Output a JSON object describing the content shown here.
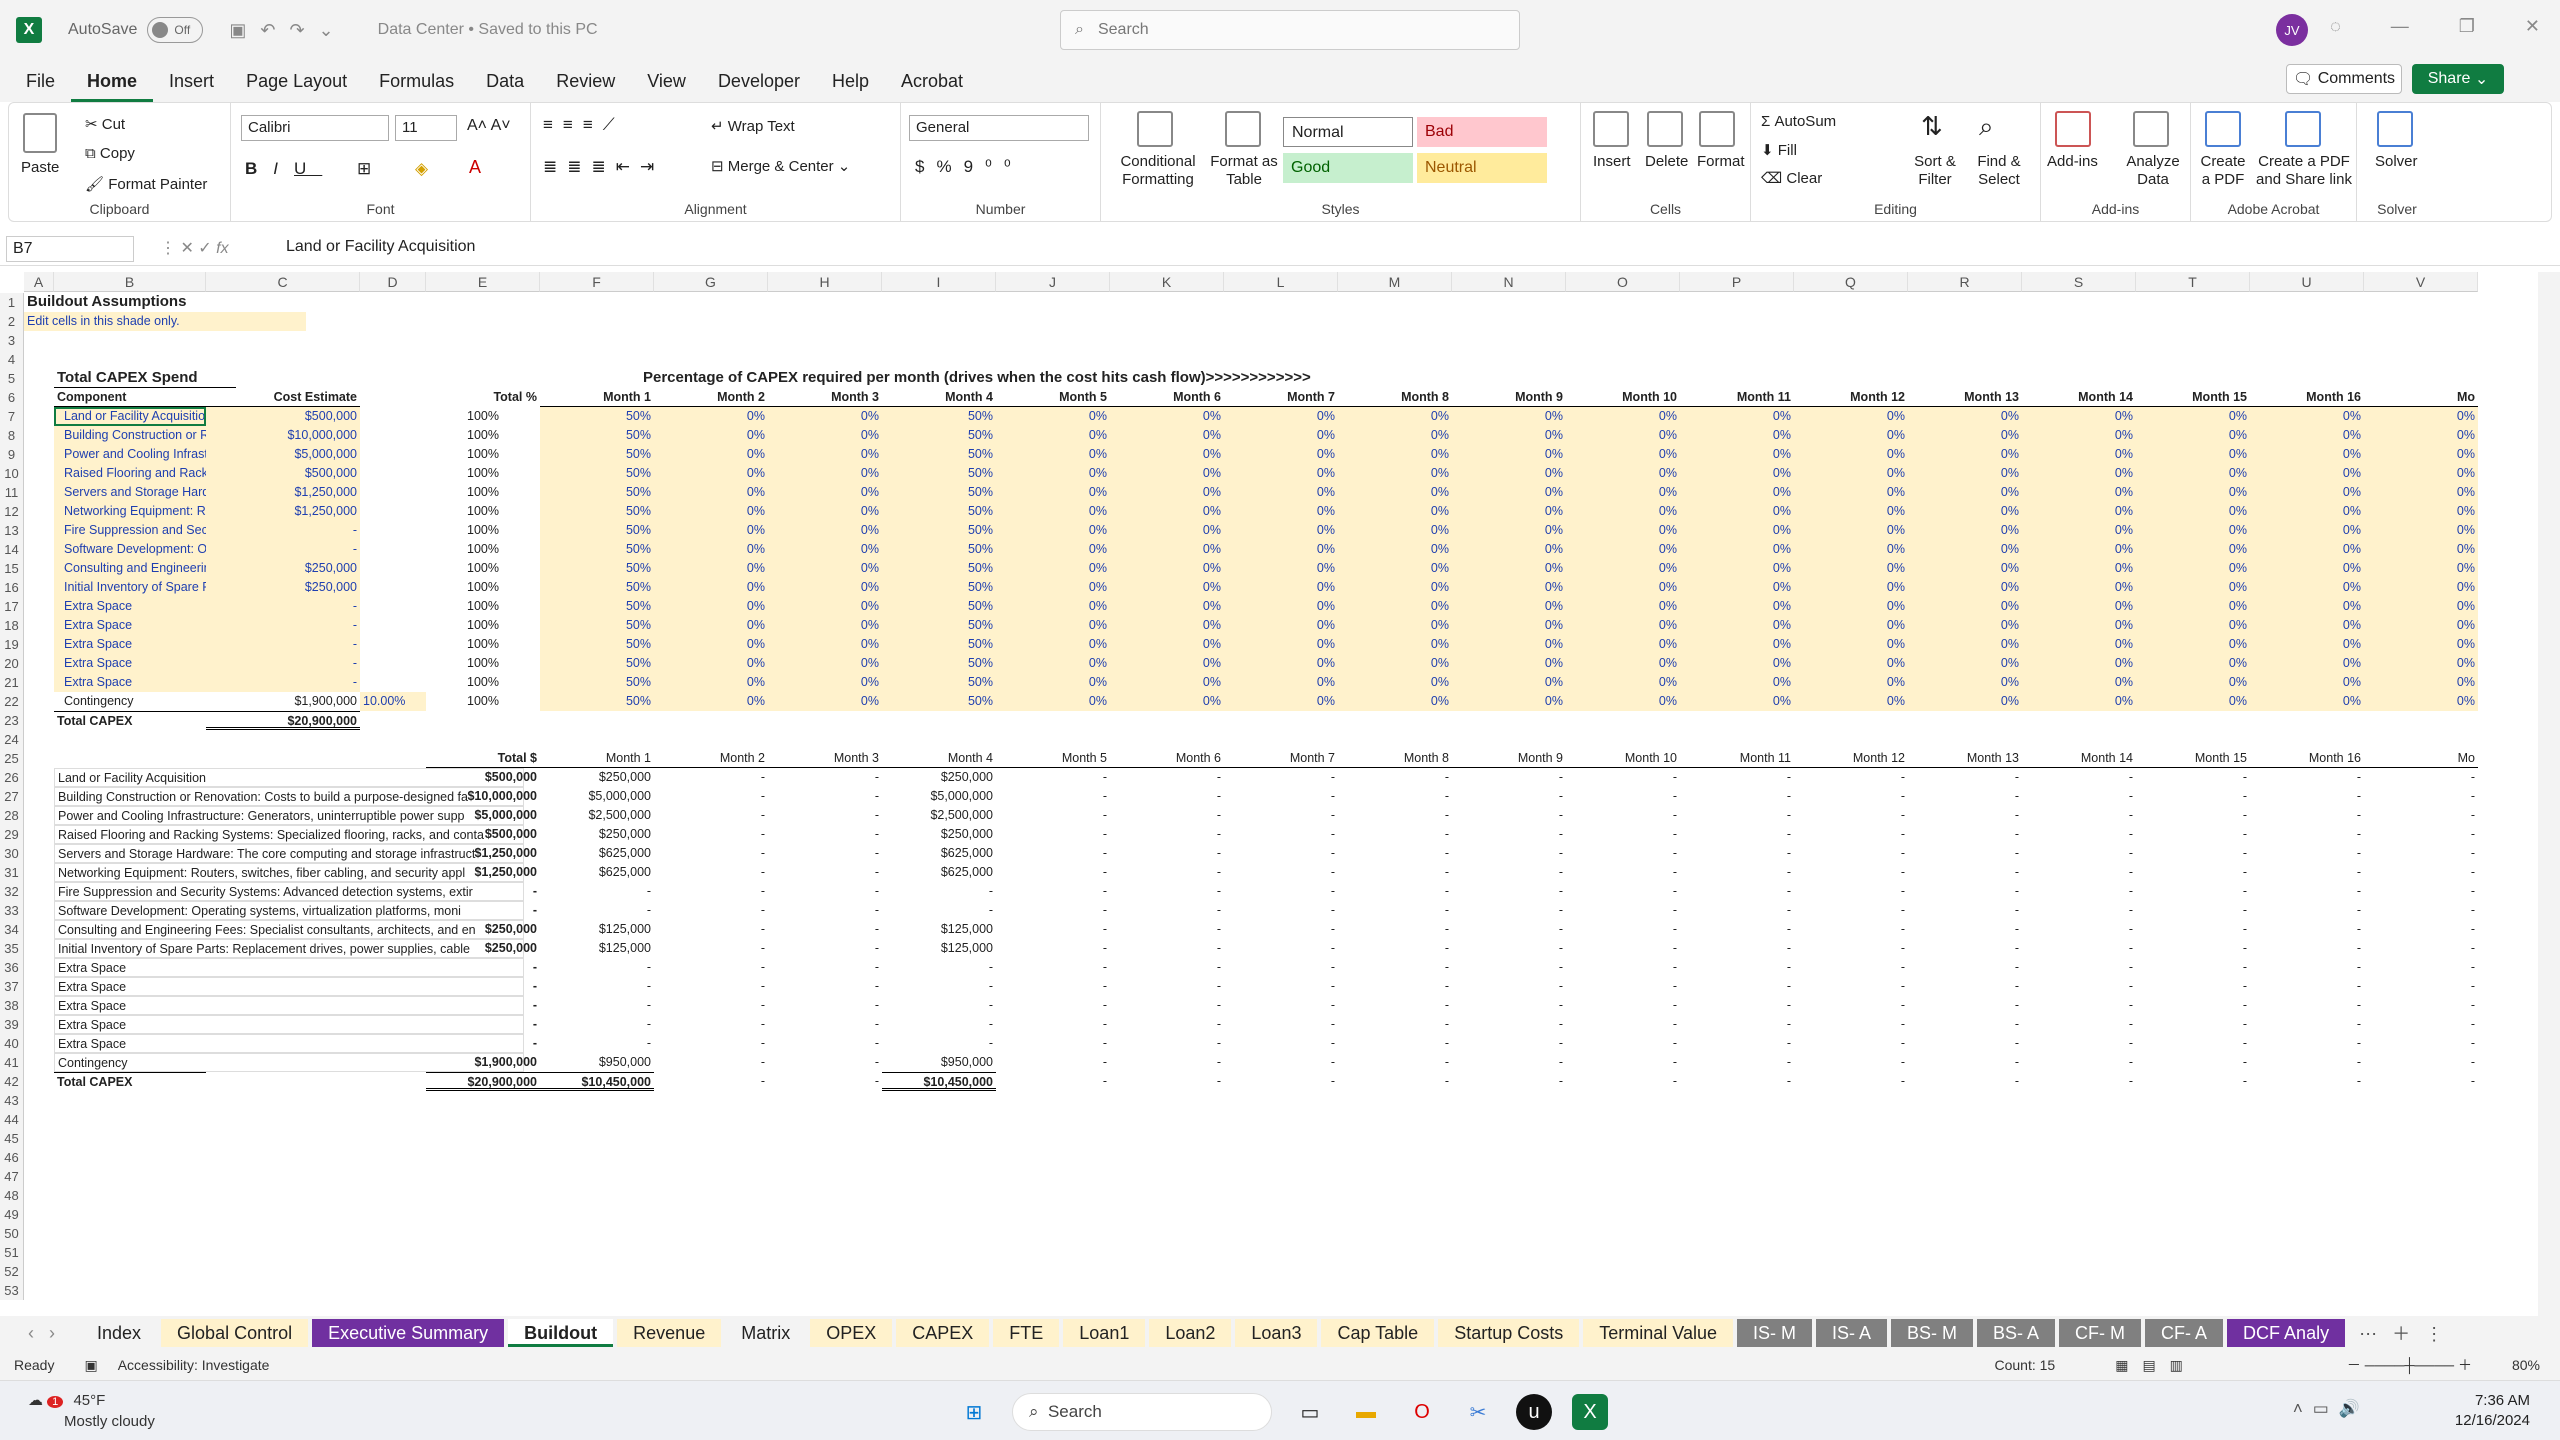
{
  "titlebar": {
    "autosave": "AutoSave",
    "toggle": "Off",
    "doc_title": "Data Center • Saved to this PC",
    "search": "Search",
    "avatar": "JV"
  },
  "menu": [
    "File",
    "Home",
    "Insert",
    "Page Layout",
    "Formulas",
    "Data",
    "Review",
    "View",
    "Developer",
    "Help",
    "Acrobat"
  ],
  "actions": {
    "comments": "Comments",
    "share": "Share"
  },
  "ribbon": {
    "clipboard": {
      "label": "Clipboard",
      "paste": "Paste",
      "cut": "Cut",
      "copy": "Copy",
      "format_painter": "Format Painter"
    },
    "font": {
      "label": "Font",
      "family": "Calibri",
      "size": "11"
    },
    "alignment": {
      "label": "Alignment",
      "wrap": "Wrap Text",
      "merge": "Merge & Center"
    },
    "number": {
      "label": "Number",
      "format": "General"
    },
    "styles": {
      "label": "Styles",
      "conditional": "Conditional Formatting",
      "format_table": "Format as Table",
      "normal": "Normal",
      "bad": "Bad",
      "good": "Good",
      "neutral": "Neutral"
    },
    "cells": {
      "label": "Cells",
      "insert": "Insert",
      "delete": "Delete",
      "format": "Format"
    },
    "editing": {
      "label": "Editing",
      "autosum": "AutoSum",
      "fill": "Fill",
      "clear": "Clear",
      "sort": "Sort & Filter",
      "find": "Find & Select"
    },
    "addins": {
      "label": "Add-ins",
      "addins": "Add-ins",
      "analyze": "Analyze Data"
    },
    "acrobat": {
      "label": "Adobe Acrobat",
      "create": "Create a PDF",
      "share": "Create a PDF and Share link"
    },
    "solver": {
      "label": "Solver",
      "solver": "Solver"
    }
  },
  "formula": {
    "namebox": "B7",
    "content": "Land or Facility Acquisition"
  },
  "columns": [
    "A",
    "B",
    "C",
    "D",
    "E",
    "F",
    "G",
    "H",
    "I",
    "J",
    "K",
    "L",
    "M",
    "N",
    "O",
    "P",
    "Q",
    "R",
    "S",
    "T",
    "U",
    "V"
  ],
  "sheet": {
    "title": "Buildout Assumptions",
    "note": "Edit cells in this shade only.",
    "sec1_title": "Total CAPEX Spend",
    "sec1_pct_title": "Percentage of CAPEX required per month (drives when the cost hits cash flow)>>>>>>>>>>>>",
    "hdr_component": "Component",
    "hdr_cost": "Cost Estimate",
    "hdr_totalpct": "Total %",
    "hdr_total": "Total $",
    "months": [
      "Month 1",
      "Month 2",
      "Month 3",
      "Month 4",
      "Month 5",
      "Month 6",
      "Month 7",
      "Month 8",
      "Month 9",
      "Month 10",
      "Month 11",
      "Month 12",
      "Month 13",
      "Month 14",
      "Month 15",
      "Month 16",
      "Mo"
    ],
    "components_short": [
      "Land or Facility Acquisition",
      "Building Construction or Renovation: C",
      "Power and Cooling Infrastructure: Gen",
      "Raised Flooring and Racking Systems: S",
      "Servers and Storage Hardware: The cor",
      "Networking Equipment: Routers, switc",
      "Fire Suppression and Security Systems",
      "Software Development: Operating sys",
      "Consulting and Engineering Fees: Spec",
      "Initial Inventory of Spare Parts: Replac",
      "Extra Space",
      "Extra Space",
      "Extra Space",
      "Extra Space",
      "Extra Space",
      "Contingency"
    ],
    "components_long": [
      "Land or Facility Acquisition",
      "Building Construction or Renovation: Costs to build a purpose-designed fa",
      "Power and Cooling Infrastructure: Generators, uninterruptible power supp",
      "Raised Flooring and Racking Systems: Specialized flooring, racks, and conta",
      "Servers and Storage Hardware: The core computing and storage infrastruct",
      "Networking Equipment: Routers, switches, fiber cabling, and security appl",
      "Fire Suppression and Security Systems: Advanced detection systems, extir",
      "Software Development: Operating systems, virtualization platforms, moni",
      "Consulting and Engineering Fees: Specialist consultants, architects, and en",
      "Initial Inventory of Spare Parts: Replacement drives, power supplies, cable",
      "Extra Space",
      "Extra Space",
      "Extra Space",
      "Extra Space",
      "Extra Space",
      "Contingency"
    ],
    "costs": [
      "$500,000",
      "$10,000,000",
      "$5,000,000",
      "$500,000",
      "$1,250,000",
      "$1,250,000",
      "-",
      "-",
      "$250,000",
      "$250,000",
      "-",
      "-",
      "-",
      "-",
      "-",
      "$1,900,000"
    ],
    "contingency_pct": "10.00%",
    "total_pct": "100%",
    "pct_m1": "50%",
    "pct_m4": "50%",
    "pct_other": "0%",
    "total_label": "Total CAPEX",
    "total_cost": "$20,900,000",
    "totals2": [
      "$500,000",
      "$10,000,000",
      "$5,000,000",
      "$500,000",
      "$1,250,000",
      "$1,250,000",
      "-",
      "-",
      "$250,000",
      "$250,000",
      "-",
      "-",
      "-",
      "-",
      "-",
      "$1,900,000"
    ],
    "m1_vals": [
      "$250,000",
      "$5,000,000",
      "$2,500,000",
      "$250,000",
      "$625,000",
      "$625,000",
      "-",
      "-",
      "$125,000",
      "$125,000",
      "-",
      "-",
      "-",
      "-",
      "-",
      "$950,000"
    ],
    "total2_sum": "$20,900,000",
    "total2_m1": "$10,450,000",
    "total2_m4": "$10,450,000",
    "dash": "-"
  },
  "tabs": [
    "Index",
    "Global Control",
    "Executive Summary",
    "Buildout",
    "Revenue",
    "Matrix",
    "OPEX",
    "CAPEX",
    "FTE",
    "Loan1",
    "Loan2",
    "Loan3",
    "Cap Table",
    "Startup Costs",
    "Terminal Value",
    "IS- M",
    "IS- A",
    "BS- M",
    "BS- A",
    "CF- M",
    "CF- A",
    "DCF Analy"
  ],
  "status": {
    "ready": "Ready",
    "accessibility": "Accessibility: Investigate",
    "count": "Count: 15",
    "zoom": "80%"
  },
  "taskbar": {
    "temp": "45°F",
    "weather": "Mostly cloudy",
    "badge": "1",
    "search": "Search",
    "time": "7:36 AM",
    "date": "12/16/2024"
  }
}
